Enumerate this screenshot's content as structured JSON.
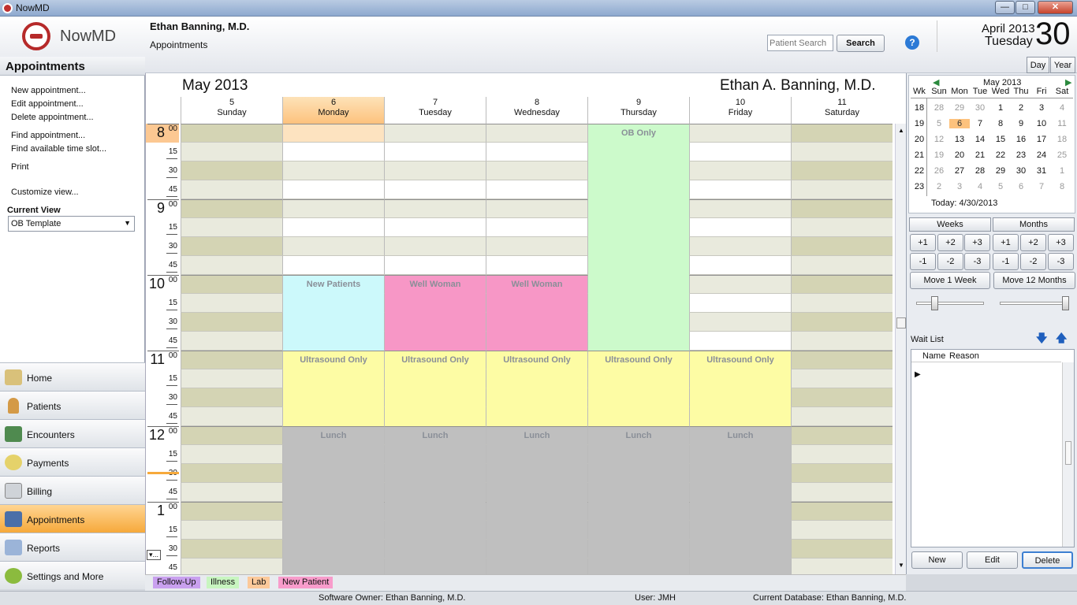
{
  "window": {
    "title": "NowMD",
    "btn_min": "—",
    "btn_max": "□",
    "btn_close": "✕"
  },
  "header": {
    "doctor": "Ethan Banning, M.D.",
    "section": "Appointments",
    "search_placeholder": "Patient Search",
    "search_button": "Search",
    "help": "?",
    "month_year": "April 2013",
    "weekday": "Tuesday",
    "day": "30",
    "view_day": "Day",
    "view_year": "Year"
  },
  "logo": {
    "text": "NowMD"
  },
  "left": {
    "title": "Appointments",
    "links": [
      "New appointment...",
      "Edit appointment...",
      "Delete appointment...",
      "Find appointment...",
      "Find available time slot...",
      "Print",
      "Customize view..."
    ],
    "current_view_label": "Current View",
    "current_view_value": "OB Template",
    "nav": [
      "Home",
      "Patients",
      "Encounters",
      "Payments",
      "Billing",
      "Appointments",
      "Reports",
      "Settings and More"
    ]
  },
  "calendar": {
    "month": "May 2013",
    "provider": "Ethan A. Banning, M.D.",
    "days": [
      {
        "num": "5",
        "name": "Sunday"
      },
      {
        "num": "6",
        "name": "Monday"
      },
      {
        "num": "7",
        "name": "Tuesday"
      },
      {
        "num": "8",
        "name": "Wednesday"
      },
      {
        "num": "9",
        "name": "Thursday"
      },
      {
        "num": "10",
        "name": "Friday"
      },
      {
        "num": "11",
        "name": "Saturday"
      }
    ],
    "hours": [
      "8",
      "9",
      "10",
      "11",
      "12",
      "1"
    ],
    "minutes": [
      "00",
      "15",
      "30",
      "45"
    ],
    "blocks": {
      "ob_only": "OB Only",
      "new_patients": "New Patients",
      "well_woman": "Well Woman",
      "ultrasound": "Ultrasound Only",
      "lunch": "Lunch"
    },
    "more_indicator": "▾..."
  },
  "minical": {
    "title": "May 2013",
    "headers": [
      "Wk",
      "Sun",
      "Mon",
      "Tue",
      "Wed",
      "Thu",
      "Fri",
      "Sat"
    ],
    "rows": [
      [
        "18",
        "28",
        "29",
        "30",
        "1",
        "2",
        "3",
        "4"
      ],
      [
        "19",
        "5",
        "6",
        "7",
        "8",
        "9",
        "10",
        "11"
      ],
      [
        "20",
        "12",
        "13",
        "14",
        "15",
        "16",
        "17",
        "18"
      ],
      [
        "21",
        "19",
        "20",
        "21",
        "22",
        "23",
        "24",
        "25"
      ],
      [
        "22",
        "26",
        "27",
        "28",
        "29",
        "30",
        "31",
        "1"
      ],
      [
        "23",
        "2",
        "3",
        "4",
        "5",
        "6",
        "7",
        "8"
      ]
    ],
    "today": "Today: 4/30/2013"
  },
  "nav_buttons": {
    "weeks": "Weeks",
    "months": "Months",
    "plus": [
      "+1",
      "+2",
      "+3"
    ],
    "minus": [
      "-1",
      "-2",
      "-3"
    ],
    "move_week": "Move 1 Week",
    "move_months": "Move 12 Months"
  },
  "waitlist": {
    "title": "Wait List",
    "col_name": "Name",
    "col_reason": "Reason",
    "new": "New",
    "edit": "Edit",
    "delete": "Delete"
  },
  "legend": [
    {
      "label": "Follow-Up",
      "color": "#c9a0ef"
    },
    {
      "label": "Illness",
      "color": "#c8f5c0"
    },
    {
      "label": "Lab",
      "color": "#fcc99a"
    },
    {
      "label": "New Patient",
      "color": "#f89ccb"
    }
  ],
  "status": {
    "owner": "Software Owner: Ethan Banning, M.D.",
    "user": "User: JMH",
    "database": "Current Database: Ethan Banning, M.D."
  },
  "colors": {
    "selected_day": "#fdc27d",
    "olive": "#d4d4b4",
    "light_olive": "#e9eadd",
    "ob": "#ccfacb",
    "new_patients": "#ccf9fb",
    "well_woman": "#f797c6",
    "ultrasound": "#fdfca4",
    "lunch": "#bfbfbf",
    "nav_active": "#f8b04e"
  }
}
